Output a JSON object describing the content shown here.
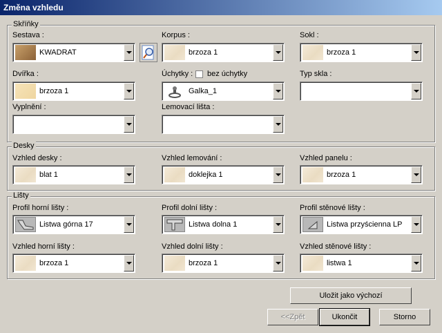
{
  "window": {
    "title": "Změna vzhledu"
  },
  "cabinets": {
    "group_title": "Skříňky",
    "sestava": {
      "label": "Sestava :",
      "value": "KWADRAT"
    },
    "korpus": {
      "label": "Korpus :",
      "value": "brzoza 1"
    },
    "sokl": {
      "label": "Sokl :",
      "value": "brzoza 1"
    },
    "dvirka": {
      "label": "Dvířka :",
      "value": "brzoza 1"
    },
    "uchytky": {
      "label": "Úchytky :",
      "checkbox_label": "bez úchytky",
      "checked": false,
      "value": "Galka_1"
    },
    "typ_skla": {
      "label": "Typ skla :",
      "value": ""
    },
    "vyplneni": {
      "label": "Vyplnění :",
      "value": ""
    },
    "lemovaci_lista": {
      "label": "Lemovací lišta :",
      "value": ""
    }
  },
  "desks": {
    "group_title": "Desky",
    "vzhled_desky": {
      "label": "Vzhled desky :",
      "value": "blat 1"
    },
    "vzhled_lemovani": {
      "label": "Vzhled lemování :",
      "value": "doklejka 1"
    },
    "vzhled_panelu": {
      "label": "Vzhled panelu :",
      "value": "brzoza 1"
    }
  },
  "strips": {
    "group_title": "Lišty",
    "profil_horni": {
      "label": "Profil horní lišty :",
      "value": "Listwa górna 17"
    },
    "profil_dolni": {
      "label": "Profil dolní lišty :",
      "value": "Listwa dolna 1"
    },
    "profil_stenove": {
      "label": "Profil stěnové lišty :",
      "value": "Listwa przyścienna LP"
    },
    "vzhled_horni": {
      "label": "Vzhled horní lišty :",
      "value": "brzoza 1"
    },
    "vzhled_dolni": {
      "label": "Vzhled dolní lišty :",
      "value": "brzoza 1"
    },
    "vzhled_stenove": {
      "label": "Vzhled stěnové lišty :",
      "value": "listwa 1"
    }
  },
  "buttons": {
    "save_default": "Uložit jako výchozí",
    "back": "<<Zpět",
    "finish": "Ukončit",
    "cancel": "Storno"
  }
}
